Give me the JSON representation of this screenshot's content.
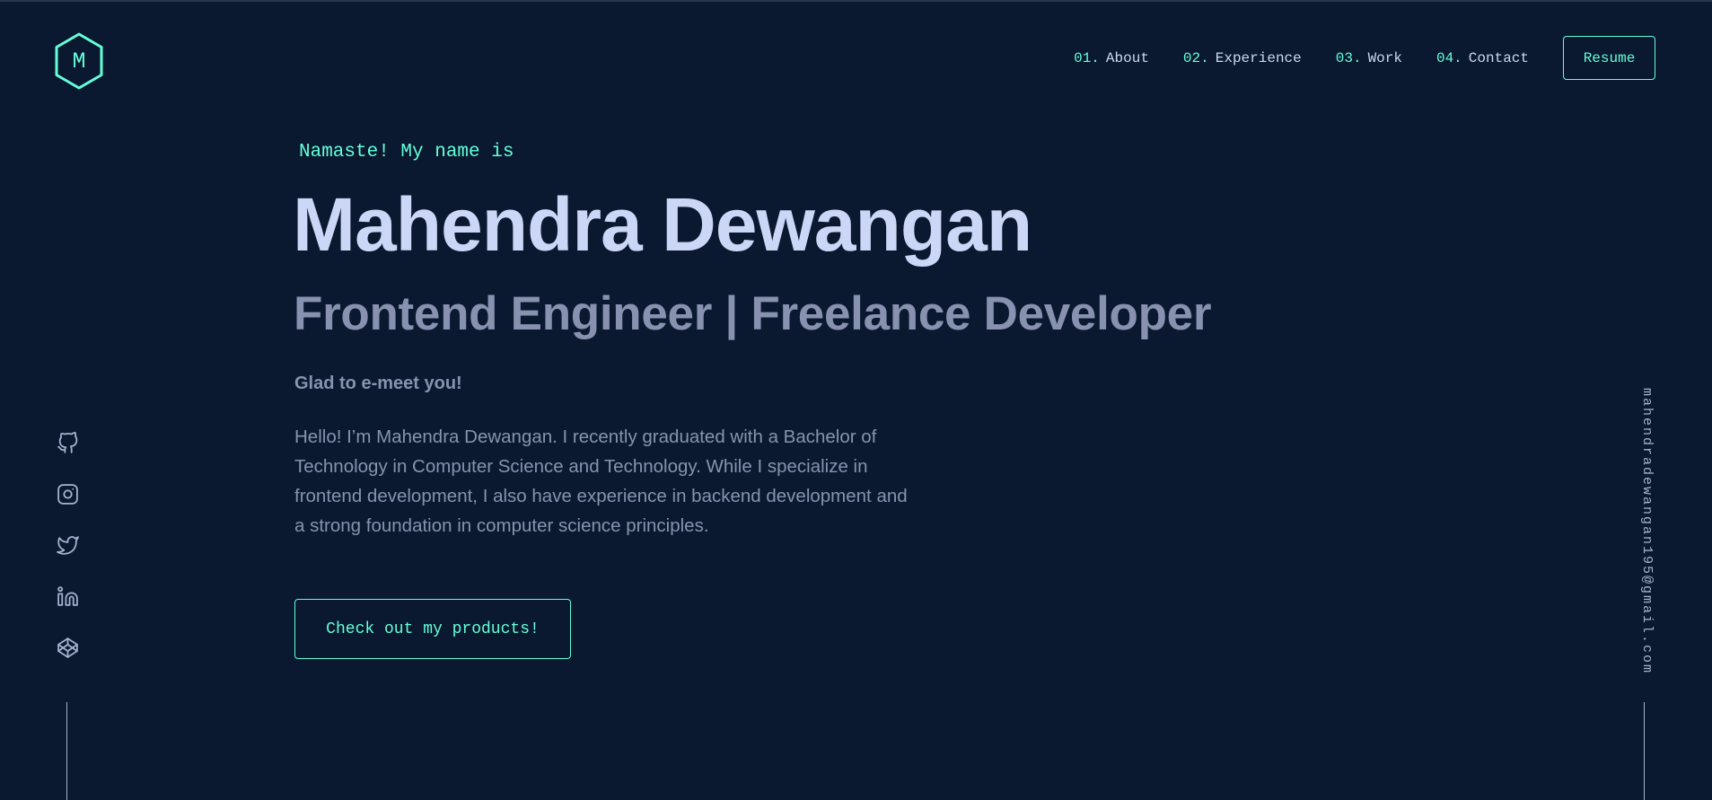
{
  "logo": {
    "letter": "M"
  },
  "nav": {
    "items": [
      {
        "num": "01.",
        "label": "About"
      },
      {
        "num": "02.",
        "label": "Experience"
      },
      {
        "num": "03.",
        "label": "Work"
      },
      {
        "num": "04.",
        "label": "Contact"
      }
    ],
    "resume_label": "Resume"
  },
  "hero": {
    "greeting": "Namaste! My name is",
    "name": "Mahendra Dewangan",
    "subtitle": "Frontend Engineer | Freelance Developer",
    "tagline": "Glad to e-meet you!",
    "bio": "Hello! I’m Mahendra Dewangan. I recently graduated with a Bachelor of Technology in Computer Science and Technology. While I specialize in frontend development, I also have experience in backend development and a strong foundation in computer science principles.",
    "cta_label": "Check out my products!"
  },
  "social": {
    "icons": [
      "github-icon",
      "instagram-icon",
      "twitter-icon",
      "linkedin-icon",
      "codepen-icon"
    ]
  },
  "email": "mahendradewangan195@gmail.com",
  "colors": {
    "background": "#0a192f",
    "accent": "#64ffda",
    "heading": "#ccd6f6",
    "text": "#8892b0"
  }
}
